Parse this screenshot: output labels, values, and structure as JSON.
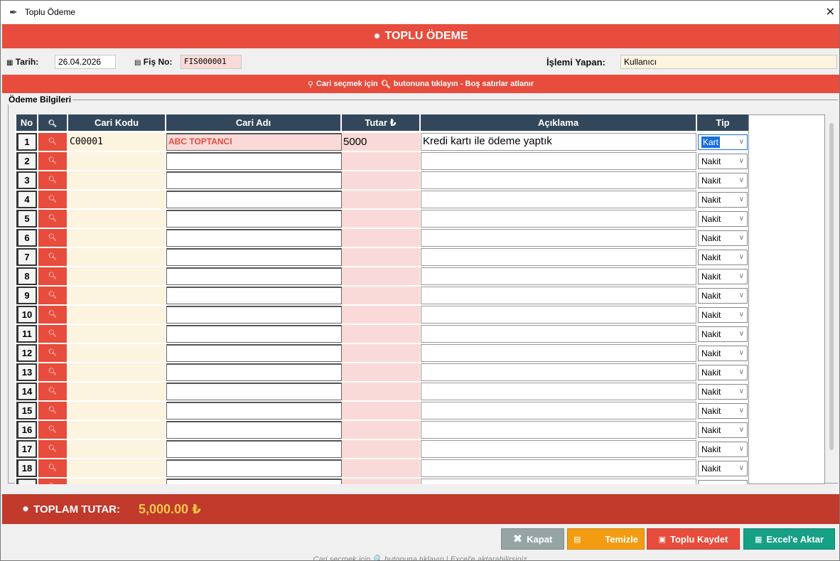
{
  "window": {
    "title": "Toplu Ödeme",
    "close": "✕"
  },
  "banner": {
    "title": "TOPLU ÖDEME"
  },
  "info": {
    "tarih_label": "Tarih:",
    "tarih_value": "26.04.2026",
    "fis_label": "Fiş No:",
    "fis_value": "FIS000001",
    "islemi_label": "İşlemi Yapan:",
    "islemi_value": "Kullanıcı"
  },
  "hint": {
    "text_before": "Cari seçmek için",
    "text_after": "butonuna tıklayın - Boş satırlar atlanır"
  },
  "group": {
    "title": "Ödeme Bilgileri"
  },
  "columns": {
    "no": "No",
    "cari_kodu": "Cari Kodu",
    "cari_adi": "Cari Adı",
    "tutar": "Tutar ₺",
    "aciklama": "Açıklama",
    "tip": "Tip"
  },
  "rows": [
    {
      "no": "1",
      "cari_kodu": "C00001",
      "cari_adi": "ABC TOPTANCI",
      "tutar": "5000",
      "aciklama": "Kredi kartı ile ödeme yaptık",
      "tip": "Kart"
    },
    {
      "no": "2",
      "cari_kodu": "",
      "cari_adi": "",
      "tutar": "",
      "aciklama": "",
      "tip": "Nakit"
    },
    {
      "no": "3",
      "cari_kodu": "",
      "cari_adi": "",
      "tutar": "",
      "aciklama": "",
      "tip": "Nakit"
    },
    {
      "no": "4",
      "cari_kodu": "",
      "cari_adi": "",
      "tutar": "",
      "aciklama": "",
      "tip": "Nakit"
    },
    {
      "no": "5",
      "cari_kodu": "",
      "cari_adi": "",
      "tutar": "",
      "aciklama": "",
      "tip": "Nakit"
    },
    {
      "no": "6",
      "cari_kodu": "",
      "cari_adi": "",
      "tutar": "",
      "aciklama": "",
      "tip": "Nakit"
    },
    {
      "no": "7",
      "cari_kodu": "",
      "cari_adi": "",
      "tutar": "",
      "aciklama": "",
      "tip": "Nakit"
    },
    {
      "no": "8",
      "cari_kodu": "",
      "cari_adi": "",
      "tutar": "",
      "aciklama": "",
      "tip": "Nakit"
    },
    {
      "no": "9",
      "cari_kodu": "",
      "cari_adi": "",
      "tutar": "",
      "aciklama": "",
      "tip": "Nakit"
    },
    {
      "no": "10",
      "cari_kodu": "",
      "cari_adi": "",
      "tutar": "",
      "aciklama": "",
      "tip": "Nakit"
    },
    {
      "no": "11",
      "cari_kodu": "",
      "cari_adi": "",
      "tutar": "",
      "aciklama": "",
      "tip": "Nakit"
    },
    {
      "no": "12",
      "cari_kodu": "",
      "cari_adi": "",
      "tutar": "",
      "aciklama": "",
      "tip": "Nakit"
    },
    {
      "no": "13",
      "cari_kodu": "",
      "cari_adi": "",
      "tutar": "",
      "aciklama": "",
      "tip": "Nakit"
    },
    {
      "no": "14",
      "cari_kodu": "",
      "cari_adi": "",
      "tutar": "",
      "aciklama": "",
      "tip": "Nakit"
    },
    {
      "no": "15",
      "cari_kodu": "",
      "cari_adi": "",
      "tutar": "",
      "aciklama": "",
      "tip": "Nakit"
    },
    {
      "no": "16",
      "cari_kodu": "",
      "cari_adi": "",
      "tutar": "",
      "aciklama": "",
      "tip": "Nakit"
    },
    {
      "no": "17",
      "cari_kodu": "",
      "cari_adi": "",
      "tutar": "",
      "aciklama": "",
      "tip": "Nakit"
    },
    {
      "no": "18",
      "cari_kodu": "",
      "cari_adi": "",
      "tutar": "",
      "aciklama": "",
      "tip": "Nakit"
    },
    {
      "no": "",
      "cari_kodu": "",
      "cari_adi": "",
      "tutar": "",
      "aciklama": "",
      "tip": ""
    }
  ],
  "total": {
    "label": "TOPLAM TUTAR:",
    "value": "5,000.00 ₺"
  },
  "buttons": {
    "kapat": "Kapat",
    "temizle": "Temizle",
    "kaydet": "Toplu Kaydet",
    "excel": "Excel'e Aktar"
  },
  "footer": {
    "text": "Cari seçmek için 🔍 butonuna tıklayın | Excel'e aktarabilirsiniz"
  },
  "icons": {
    "feather": "feather-icon",
    "bug": "bug-icon",
    "calendar": "calendar-icon",
    "receipt": "receipt-icon",
    "pin": "pin-icon",
    "search": "search-icon",
    "close": "x-icon",
    "trash": "trash-icon",
    "save": "save-icon",
    "excel": "spreadsheet-icon"
  },
  "colors": {
    "red": "#e74c3c",
    "dark_red": "#c0392b",
    "header": "#33475b",
    "gold": "#f7c948",
    "green": "#16a085",
    "orange": "#f39c12",
    "grey": "#95a5a6"
  }
}
